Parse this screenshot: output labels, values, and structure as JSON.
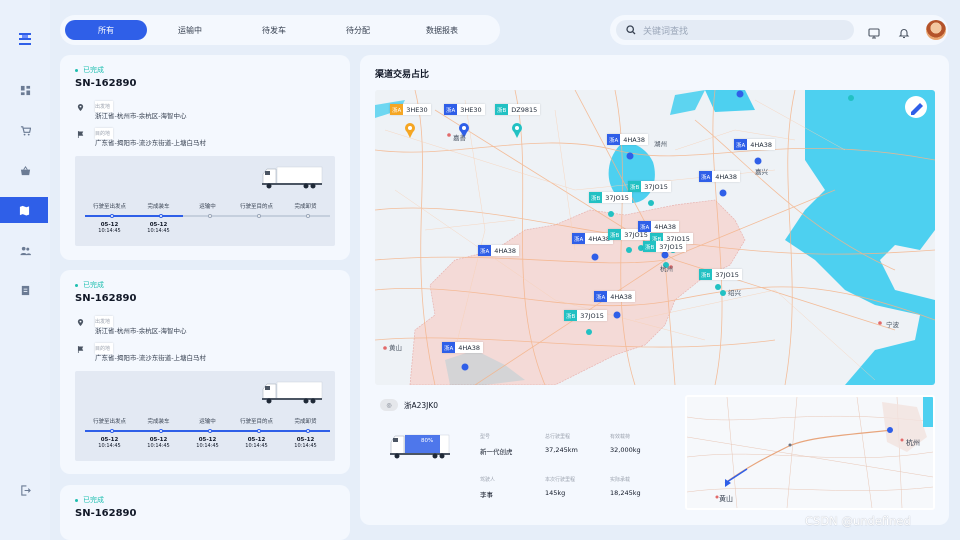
{
  "sidebar": {
    "items": [
      {
        "icon": "dashboard-icon"
      },
      {
        "icon": "cart-icon"
      },
      {
        "icon": "basket-icon"
      },
      {
        "icon": "map-icon",
        "active": true
      },
      {
        "icon": "users-icon"
      },
      {
        "icon": "document-icon"
      }
    ],
    "logout_icon": "logout-icon"
  },
  "tabs": [
    "所有",
    "运输中",
    "待发车",
    "待分配",
    "数据报表"
  ],
  "active_tab": "所有",
  "search": {
    "placeholder": "关键词查找"
  },
  "header_icons": [
    "monitor-icon",
    "bell-icon",
    "avatar"
  ],
  "shipments": [
    {
      "status": "已完成",
      "sn": "SN-162890",
      "origin_label": "出发地",
      "origin": "浙江省-杭州市-余杭区-海智中心",
      "dest_label": "目的地",
      "dest": "广东省-揭阳市-流沙东街道-上塘白马村",
      "steps": [
        "行驶至出发点",
        "完成装车",
        "运输中",
        "行驶至目的点",
        "完成卸货"
      ],
      "progress": 0.4,
      "times": [
        {
          "date": "05-12",
          "time": "10:14:45"
        },
        {
          "date": "05-12",
          "time": "10:14:45"
        }
      ]
    },
    {
      "status": "已完成",
      "sn": "SN-162890",
      "origin_label": "出发地",
      "origin": "浙江省-杭州市-余杭区-海智中心",
      "dest_label": "目的地",
      "dest": "广东省-揭阳市-流沙东街道-上塘白马村",
      "steps": [
        "行驶至出发点",
        "完成装车",
        "运输中",
        "行驶至目的点",
        "完成卸货"
      ],
      "progress": 1.0,
      "times": [
        {
          "date": "05-12",
          "time": "10:14:45"
        },
        {
          "date": "05-12",
          "time": "10:14:45"
        },
        {
          "date": "05-12",
          "time": "10:14:45"
        },
        {
          "date": "05-12",
          "time": "10:14:45"
        },
        {
          "date": "05-12",
          "time": "10:14:45"
        }
      ]
    },
    {
      "status": "已完成",
      "sn": "SN-162890"
    }
  ],
  "main": {
    "title": "渠道交易占比",
    "map_labels": {
      "cities": [
        "嘉兴",
        "湖州",
        "杭州",
        "绍兴",
        "宁波",
        "黄山",
        "嘉善"
      ],
      "vehicles": [
        {
          "prefix": "浙A",
          "plate": "3HE30",
          "color": "#f5a623"
        },
        {
          "prefix": "浙A",
          "plate": "3HE30",
          "color": "#2f5fe8"
        },
        {
          "prefix": "浙B",
          "plate": "DZ9815",
          "color": "#22c1c3"
        },
        {
          "prefix": "浙A",
          "plate": "4HA38",
          "color": "#2f5fe8"
        },
        {
          "prefix": "浙A",
          "plate": "4HA38",
          "color": "#2f5fe8"
        },
        {
          "prefix": "浙A",
          "plate": "4HA38",
          "color": "#2f5fe8"
        },
        {
          "prefix": "浙B",
          "plate": "37JO15",
          "color": "#22c1c3"
        },
        {
          "prefix": "浙B",
          "plate": "37JO15",
          "color": "#22c1c3"
        },
        {
          "prefix": "浙A",
          "plate": "4HA38",
          "color": "#2f5fe8"
        },
        {
          "prefix": "浙B",
          "plate": "37JO15",
          "color": "#22c1c3"
        },
        {
          "prefix": "浙B",
          "plate": "37JO15",
          "color": "#22c1c3"
        },
        {
          "prefix": "浙A",
          "plate": "4HA38",
          "color": "#2f5fe8"
        },
        {
          "prefix": "浙B",
          "plate": "37JO15",
          "color": "#22c1c3"
        },
        {
          "prefix": "浙B",
          "plate": "37JO15",
          "color": "#22c1c3"
        },
        {
          "prefix": "浙A",
          "plate": "4HA38",
          "color": "#2f5fe8"
        },
        {
          "prefix": "浙B",
          "plate": "37JO15",
          "color": "#22c1c3"
        },
        {
          "prefix": "浙A",
          "plate": "4HA38",
          "color": "#2f5fe8"
        }
      ]
    },
    "vehicle": {
      "plate": "浙A23JK0",
      "load": "80%",
      "fields": [
        {
          "label": "型号",
          "value": "新一代创虎"
        },
        {
          "label": "总行驶里程",
          "value": "37,245km"
        },
        {
          "label": "有效载荷",
          "value": "32,000kg"
        },
        {
          "label": "驾驶人",
          "value": "李事"
        },
        {
          "label": "本次行驶里程",
          "value": "145kg"
        },
        {
          "label": "实际承载",
          "value": "18,245kg"
        }
      ]
    },
    "minimap_labels": [
      "杭州",
      "黄山"
    ]
  },
  "watermark": "CSDN @undefined"
}
